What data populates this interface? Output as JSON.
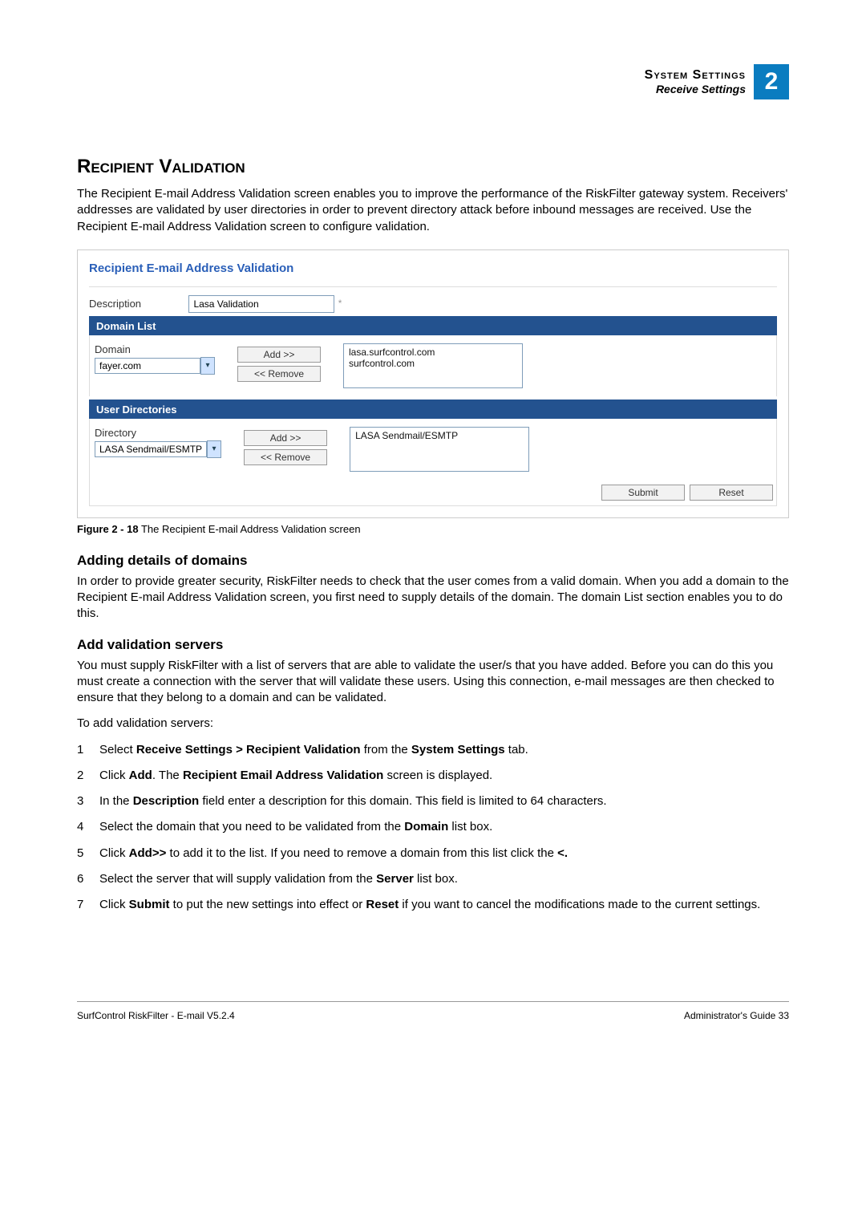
{
  "header": {
    "title": "System Settings",
    "sub": "Receive Settings",
    "badge": "2"
  },
  "h1": "Recipient Validation",
  "intro": "The Recipient E-mail Address Validation screen enables you to improve the performance of the RiskFilter gateway system. Receivers' addresses are validated by user directories in order to prevent directory attack before inbound messages are received. Use the Recipient E-mail Address Validation screen to configure validation.",
  "figure": {
    "title": "Recipient E-mail Address Validation",
    "desc_label": "Description",
    "desc_value": "Lasa Validation",
    "domain_bar": "Domain List",
    "domain_label": "Domain",
    "domain_value": "fayer.com",
    "domain_list": [
      "lasa.surfcontrol.com",
      "surfcontrol.com"
    ],
    "add_btn": "Add >>",
    "remove_btn": "<< Remove",
    "dir_bar": "User Directories",
    "dir_label": "Directory",
    "dir_value": "LASA Sendmail/ESMTP",
    "dir_list": [
      "LASA Sendmail/ESMTP"
    ],
    "submit": "Submit",
    "reset": "Reset"
  },
  "caption_b": "Figure 2 - 18",
  "caption_t": " The Recipient E-mail Address Validation screen",
  "h2a": "Adding details of domains",
  "p2": "In order to provide greater security, RiskFilter needs to check that the user comes from a valid domain. When you add a domain to the Recipient E-mail Address Validation screen, you first need to supply details of the domain. The domain List section enables you to do this.",
  "h2b": "Add validation servers",
  "p3": "You must supply RiskFilter with a list of servers that are able to validate the user/s that you have added. Before you can do this you must create a connection with the server that will validate these users. Using this connection, e-mail messages are then checked to ensure that they belong to a domain and can be validated.",
  "p4": "To add validation servers:",
  "steps": [
    "Select <b>Receive Settings > Recipient Validation</b> from the <b>System Settings</b> tab.",
    "Click <b>Add</b>. The <b>Recipient Email Address Validation</b> screen is displayed.",
    "In the <b>Description</b> field enter a description for this domain. This field is limited to 64 characters.",
    "Select the domain that you need to be validated from the <b>Domain</b> list box.",
    "Click <b>Add>></b> to add it to the list. If you need to remove a domain from this list click the <b><<Remove</b>.",
    "Select the server that will supply validation from the <b>Server</b> list box.",
    "Click <b>Submit</b> to put the new settings into effect or <b>Reset</b> if you want to cancel the modifications made to the current settings."
  ],
  "footer": {
    "left": "SurfControl RiskFilter - E-mail V5.2.4",
    "right": "Administrator's Guide    33"
  }
}
